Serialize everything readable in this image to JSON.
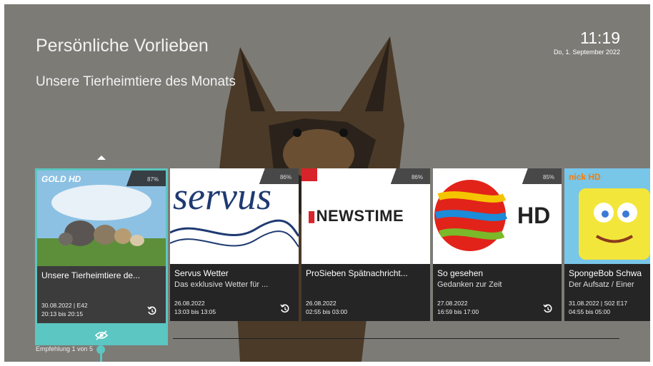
{
  "header": {
    "title": "Persönliche Vorlieben",
    "subtitle": "Unsere Tierheimtiere des Monats",
    "time": "11:19",
    "date": "Do, 1. September 2022"
  },
  "cards": [
    {
      "logo": "GOLD HD",
      "percent": "87%",
      "title": "Unsere Tierheimtiere de...",
      "subtitle": "",
      "date": "30.08.2022 | E42",
      "time": "20:13 bis 20:15",
      "replay": true
    },
    {
      "logo": "servus",
      "percent": "86%",
      "title": "Servus Wetter",
      "subtitle": "Das exklusive Wetter für ...",
      "date": "26.08.2022",
      "time": "13:03 bis 13:05",
      "replay": true
    },
    {
      "logo": "NEWSTIME",
      "percent": "86%",
      "title": "ProSieben Spätnachricht...",
      "subtitle": "",
      "date": "26.08.2022",
      "time": "02:55 bis 03:00",
      "replay": false
    },
    {
      "logo": "HD",
      "percent": "85%",
      "title": "So gesehen",
      "subtitle": "Gedanken zur Zeit",
      "date": "27.08.2022",
      "time": "16:59 bis 17:00",
      "replay": true
    },
    {
      "logo": "nick HD",
      "percent": "",
      "title": "SpongeBob Schwa",
      "subtitle": "Der Aufsatz / Einer",
      "date": "31.08.2022 | S02 E17",
      "time": "04:55 bis 05:00",
      "replay": false
    }
  ],
  "footer": {
    "counter": "Empfehlung 1 von 5"
  },
  "colors": {
    "accent": "#5cc6c2",
    "background": "#7c7a75",
    "card": "#252525"
  },
  "icons": {
    "replay": "replay-icon",
    "hidden": "eye-off-icon"
  }
}
